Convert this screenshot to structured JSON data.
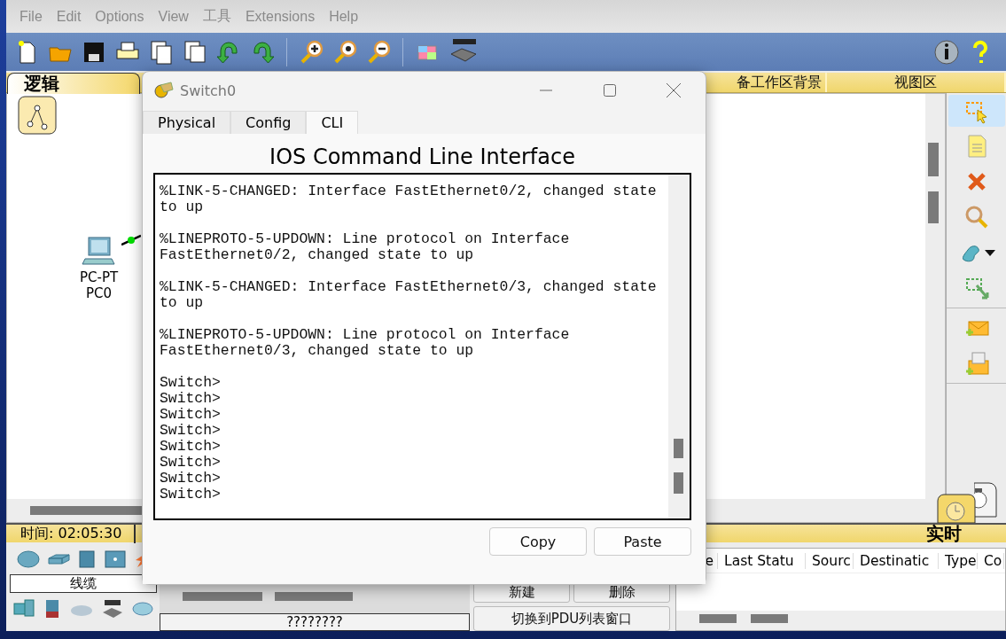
{
  "menu": [
    "File",
    "Edit",
    "Options",
    "View",
    "工具",
    "Extensions",
    "Help"
  ],
  "workspace": {
    "mode_tab": "逻辑",
    "header_columns": [
      "备工作区背景",
      "视图区"
    ],
    "devices": [
      {
        "model": "PC-PT",
        "name": "PC0"
      }
    ]
  },
  "status": {
    "time": "时间: 02:05:30",
    "mode": "实时"
  },
  "device_panel": {
    "category": "线缆",
    "subcategory": "????????"
  },
  "scenario": {
    "buttons": [
      "新建",
      "删除"
    ],
    "toggle": "切换到PDU列表窗口"
  },
  "pdu_table": {
    "columns": [
      "e",
      "Last Statu",
      "Sourc",
      "Destinatic",
      "Type",
      "Co"
    ]
  },
  "dialog": {
    "title": "Switch0",
    "tabs": [
      {
        "label": "Physical",
        "selected": false
      },
      {
        "label": "Config",
        "selected": false
      },
      {
        "label": "CLI",
        "selected": true
      }
    ],
    "heading": "IOS Command Line Interface",
    "messages": [
      "%LINK-5-CHANGED: Interface FastEthernet0/2, changed state to up",
      "%LINEPROTO-5-UPDOWN: Line protocol on Interface FastEthernet0/2, changed state to up",
      "%LINK-5-CHANGED: Interface FastEthernet0/3, changed state to up",
      "%LINEPROTO-5-UPDOWN: Line protocol on Interface FastEthernet0/3, changed state to up"
    ],
    "prompts": [
      "Switch>",
      "Switch>",
      "Switch>",
      "Switch>",
      "Switch>",
      "Switch>",
      "Switch>",
      "Switch>"
    ],
    "buttons": [
      "Copy",
      "Paste"
    ]
  }
}
